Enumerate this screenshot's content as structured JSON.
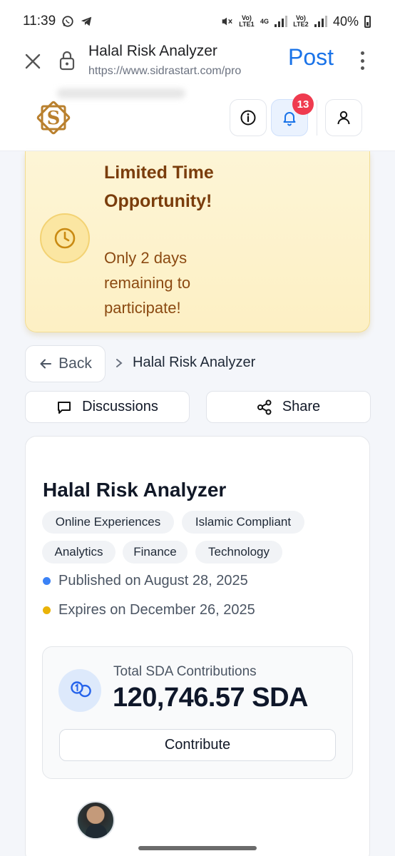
{
  "status_bar": {
    "time": "11:39",
    "network_1": "Vo) LTE1",
    "network_4g": "4G",
    "network_2": "Vo) LTE2",
    "battery": "40%"
  },
  "browser": {
    "title": "Halal Risk Analyzer",
    "url": "https://www.sidrastart.com/pro",
    "post_label": "Post"
  },
  "header": {
    "notification_count": "13"
  },
  "promo": {
    "title": "Limited Time Opportunity!",
    "subtitle": "Only 2 days remaining to participate!"
  },
  "nav": {
    "back_label": "Back",
    "breadcrumb": "Halal Risk Analyzer"
  },
  "actions": {
    "discussions_label": "Discussions",
    "share_label": "Share"
  },
  "project": {
    "title": "Halal Risk Analyzer",
    "tags": [
      "Online Experiences",
      "Islamic Compliant",
      "Analytics",
      "Finance",
      "Technology"
    ],
    "published": "Published on August 28, 2025",
    "expires": "Expires on December 26, 2025",
    "contributions_label": "Total SDA Contributions",
    "contributions_value": "120,746.57 SDA",
    "contribute_label": "Contribute"
  },
  "colors": {
    "accent": "#1a73e8",
    "published_dot": "#3b82f6",
    "expires_dot": "#eab308",
    "badge": "#ef3b4f",
    "promo_title": "#7a3d0c"
  }
}
